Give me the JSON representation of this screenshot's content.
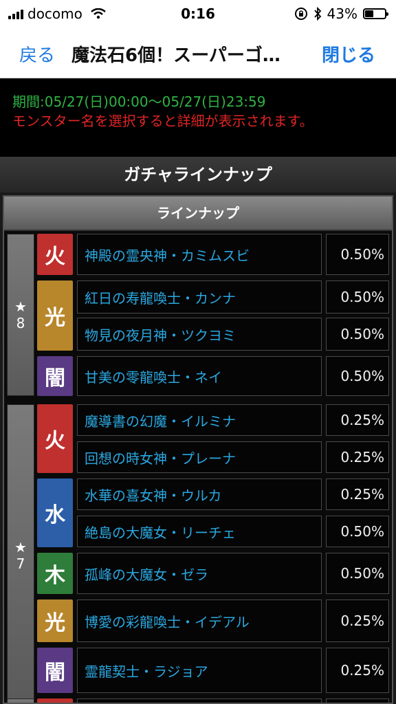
{
  "status_bar": {
    "carrier": "docomo",
    "time": "0:16",
    "battery_percent": "43%",
    "battery_level": 0.43
  },
  "nav": {
    "back": "戻る",
    "title": "魔法石6個！スーパーゴ…",
    "close": "閉じる"
  },
  "info": {
    "period": "期間:05/27(日)00:00〜05/27(日)23:59",
    "notice": "モンスター名を選択すると詳細が表示されます。"
  },
  "panel": {
    "title": "ガチャラインナップ",
    "table_header": "ラインナップ"
  },
  "rarity_groups": [
    {
      "label": "★",
      "value": "8"
    },
    {
      "label": "★",
      "value": "7"
    }
  ],
  "elements": [
    {
      "label": "火",
      "color": "#c0302f"
    },
    {
      "label": "光",
      "color": "#b8862b"
    },
    {
      "label": "闇",
      "color": "#5a3a84"
    },
    {
      "label": "火",
      "color": "#c0302f"
    },
    {
      "label": "水",
      "color": "#2c5fa8"
    },
    {
      "label": "木",
      "color": "#2e7d3a"
    },
    {
      "label": "光",
      "color": "#b8862b"
    },
    {
      "label": "闇",
      "color": "#5a3a84"
    }
  ],
  "lineup": [
    {
      "name": "神殿の霊央神・カミムスビ",
      "rate": "0.50%"
    },
    {
      "name": "紅日の寿龍喚士・カンナ",
      "rate": "0.50%"
    },
    {
      "name": "物見の夜月神・ツクヨミ",
      "rate": "0.50%"
    },
    {
      "name": "甘美の零龍喚士・ネイ",
      "rate": "0.50%"
    },
    {
      "name": "魔導書の幻魔・イルミナ",
      "rate": "0.25%"
    },
    {
      "name": "回想の時女神・プレーナ",
      "rate": "0.25%"
    },
    {
      "name": "水華の喜女神・ウルカ",
      "rate": "0.25%"
    },
    {
      "name": "絶島の大魔女・リーチェ",
      "rate": "0.50%"
    },
    {
      "name": "孤峰の大魔女・ゼラ",
      "rate": "0.50%"
    },
    {
      "name": "博愛の彩龍喚士・イデアル",
      "rate": "0.25%"
    },
    {
      "name": "霊龍契士・ラジョア",
      "rate": "0.25%"
    }
  ],
  "colors": {
    "link": "#1f7ae0",
    "period": "#2fb344",
    "notice": "#e02424",
    "monster_name": "#2aa7e0"
  }
}
